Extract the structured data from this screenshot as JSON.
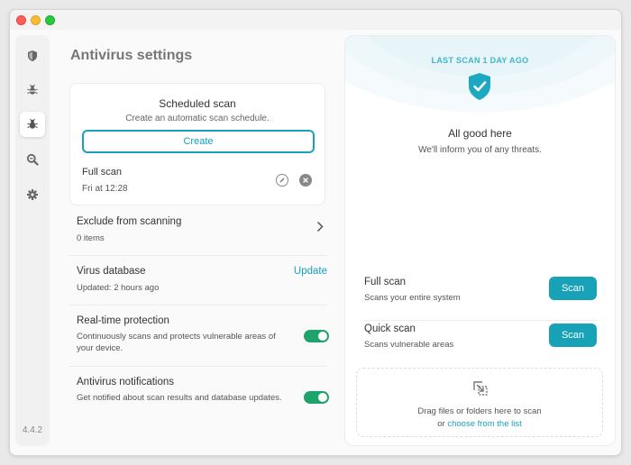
{
  "app": {
    "version": "4.4.2"
  },
  "sidebar": {
    "items": [
      {
        "name": "protection",
        "icon": "shield-icon"
      },
      {
        "name": "virus-scan",
        "icon": "bug-scan-icon"
      },
      {
        "name": "antivirus",
        "icon": "bug-icon",
        "active": true
      },
      {
        "name": "search",
        "icon": "magnifier-icon"
      },
      {
        "name": "settings",
        "icon": "gear-icon"
      }
    ]
  },
  "page": {
    "title": "Antivirus settings"
  },
  "scheduled_scan": {
    "title": "Scheduled scan",
    "subtitle": "Create an automatic scan schedule.",
    "create_label": "Create",
    "entry": {
      "title": "Full scan",
      "time": "Fri at 12:28"
    }
  },
  "settings": {
    "exclude": {
      "title": "Exclude from scanning",
      "subtitle": "0 items"
    },
    "database": {
      "title": "Virus database",
      "subtitle": "Updated: 2 hours ago",
      "action": "Update"
    },
    "realtime": {
      "title": "Real-time protection",
      "subtitle": "Continuously scans and protects vulnerable areas of your device.",
      "enabled": true
    },
    "notifications": {
      "title": "Antivirus notifications",
      "subtitle": "Get notified about scan results and database updates.",
      "enabled": true
    }
  },
  "status": {
    "last_scan": "LAST SCAN 1 DAY AGO",
    "headline": "All good here",
    "message": "We'll inform you of any threats."
  },
  "scans": [
    {
      "title": "Full scan",
      "subtitle": "Scans your entire system",
      "button": "Scan"
    },
    {
      "title": "Quick scan",
      "subtitle": "Scans vulnerable areas",
      "button": "Scan"
    }
  ],
  "dropzone": {
    "line1": "Drag files or folders here to scan",
    "prefix": "or",
    "link": "choose from the list"
  },
  "colors": {
    "accent": "#17a2b8",
    "toggle_on": "#1fa36a",
    "status": "#40b7ca"
  }
}
